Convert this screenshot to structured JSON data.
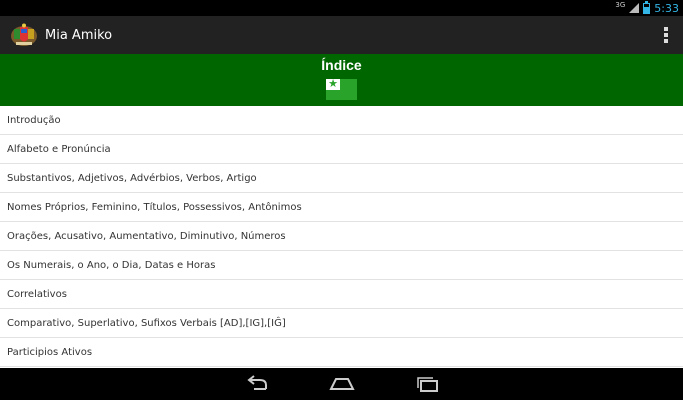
{
  "status": {
    "net_type": "3G",
    "time": "5:33"
  },
  "action_bar": {
    "title": "Mia Amiko",
    "app_icon": "coat-of-arms-icon",
    "overflow_icon": "overflow-menu-icon"
  },
  "banner": {
    "title": "Índice",
    "flag_icon": "esperanto-flag-icon"
  },
  "colors": {
    "banner_green": "#006600",
    "flag_green": "#29a329",
    "clock_blue": "#33b5e5"
  },
  "items": [
    {
      "label": "Introdução"
    },
    {
      "label": "Alfabeto e Pronúncia"
    },
    {
      "label": "Substantivos, Adjetivos, Advérbios, Verbos, Artigo"
    },
    {
      "label": "Nomes Próprios, Feminino, Títulos, Possessivos, Antônimos"
    },
    {
      "label": "Orações, Acusativo, Aumentativo, Diminutivo, Números"
    },
    {
      "label": "Os Numerais, o Ano, o Dia, Datas e Horas"
    },
    {
      "label": "Correlativos"
    },
    {
      "label": "Comparativo, Superlativo, Sufixos Verbais [AD],[IG],[IĜ]"
    },
    {
      "label": "Participios Ativos"
    }
  ],
  "nav": {
    "back_icon": "back-icon",
    "home_icon": "home-icon",
    "recents_icon": "recent-apps-icon"
  }
}
